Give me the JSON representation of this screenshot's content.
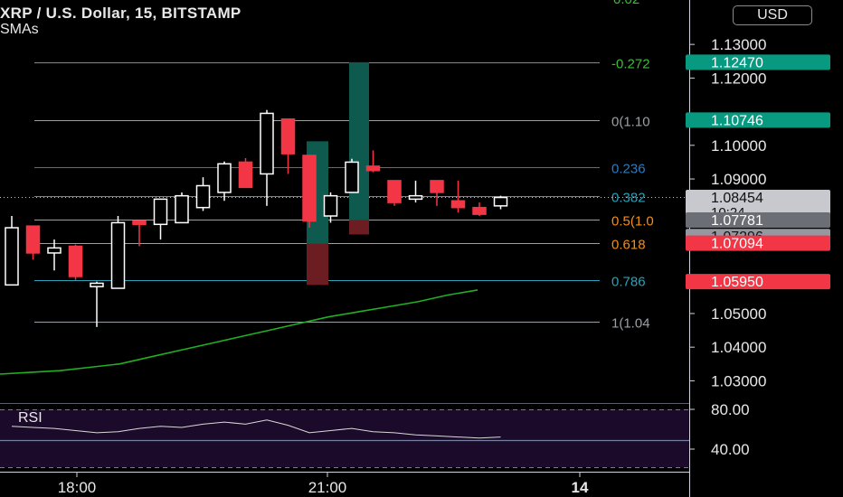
{
  "header": {
    "title": "XRP / U.S. Dollar, 15, BITSTAMP",
    "indicator": "SMAs",
    "currency_button": "USD",
    "top_clipped_label": "0.02"
  },
  "rsi": {
    "label": "RSI",
    "ticks": [
      "80.00",
      "40.00"
    ]
  },
  "colors": {
    "background": "#000000",
    "up_candle": "#ffffff",
    "down_candle": "#f23645",
    "sma_line": "#21b021",
    "rsi_line": "#d8d8d8",
    "rsi_band": "#1c0a2a",
    "price_tag_teal": "#089981",
    "price_tag_red": "#f23645",
    "price_tag_gray": "#9598a1"
  },
  "chart_data": {
    "type": "candlestick",
    "symbol": "XRP / U.S. Dollar",
    "interval": "15",
    "exchange": "BITSTAMP",
    "x_ticks": [
      "18:00",
      "21:00",
      "14"
    ],
    "y_ticks": [
      "1.13000",
      "1.12000",
      "1.10000",
      "1.09000",
      "1.05000",
      "1.04000",
      "1.03000"
    ],
    "y_range": [
      1.0242,
      1.1432
    ],
    "candles": [
      {
        "o": 1.0585,
        "h": 1.079,
        "l": 1.0585,
        "c": 1.0755
      },
      {
        "o": 1.076,
        "h": 1.076,
        "l": 1.066,
        "c": 1.068
      },
      {
        "o": 1.068,
        "h": 1.072,
        "l": 1.0628,
        "c": 1.0695
      },
      {
        "o": 1.07,
        "h": 1.0705,
        "l": 1.06,
        "c": 1.061
      },
      {
        "o": 1.058,
        "h": 1.0595,
        "l": 1.046,
        "c": 1.059
      },
      {
        "o": 1.0575,
        "h": 1.079,
        "l": 1.0575,
        "c": 1.077
      },
      {
        "o": 1.0775,
        "h": 1.0775,
        "l": 1.07,
        "c": 1.0765
      },
      {
        "o": 1.0765,
        "h": 1.0815,
        "l": 1.072,
        "c": 1.084
      },
      {
        "o": 1.077,
        "h": 1.086,
        "l": 1.077,
        "c": 1.085
      },
      {
        "o": 1.0815,
        "h": 1.0905,
        "l": 1.0805,
        "c": 1.088
      },
      {
        "o": 1.086,
        "h": 1.0952,
        "l": 1.0835,
        "c": 1.0945
      },
      {
        "o": 1.095,
        "h": 1.0962,
        "l": 1.0875,
        "c": 1.0875
      },
      {
        "o": 1.0915,
        "h": 1.1105,
        "l": 1.082,
        "c": 1.1095
      },
      {
        "o": 1.1078,
        "h": 1.1078,
        "l": 1.0915,
        "c": 1.0975
      },
      {
        "o": 1.097,
        "h": 1.097,
        "l": 1.0755,
        "c": 1.0775
      },
      {
        "o": 1.079,
        "h": 1.086,
        "l": 1.077,
        "c": 1.085
      },
      {
        "o": 1.086,
        "h": 1.096,
        "l": 1.086,
        "c": 1.095
      },
      {
        "o": 1.0938,
        "h": 1.0985,
        "l": 1.092,
        "c": 1.0925
      },
      {
        "o": 1.0895,
        "h": 1.0895,
        "l": 1.082,
        "c": 1.083
      },
      {
        "o": 1.084,
        "h": 1.0895,
        "l": 1.083,
        "c": 1.085
      },
      {
        "o": 1.0895,
        "h": 1.0895,
        "l": 1.082,
        "c": 1.086
      },
      {
        "o": 1.0835,
        "h": 1.0895,
        "l": 1.08,
        "c": 1.0815
      },
      {
        "o": 1.0815,
        "h": 1.083,
        "l": 1.079,
        "c": 1.0795
      },
      {
        "o": 1.082,
        "h": 1.085,
        "l": 1.081,
        "c": 1.0845
      }
    ],
    "sma": [
      1.032,
      1.0325,
      1.033,
      1.034,
      1.035,
      1.037,
      1.039,
      1.041,
      1.043,
      1.045,
      1.047,
      1.049,
      1.0505,
      1.052,
      1.0535,
      1.0555,
      1.057
    ],
    "fib_levels": [
      {
        "label": "-0.272",
        "price": 1.1247,
        "color": "#3dbb3d"
      },
      {
        "label": "0(1.10",
        "price": 1.1075,
        "color": "#9aa0a6"
      },
      {
        "label": "0.236",
        "price": 1.0935,
        "color": "#2a7bbf"
      },
      {
        "label": "0.382",
        "price": 1.0848,
        "color": "#2aa1b8"
      },
      {
        "label": "0.5(1.0",
        "price": 1.0778,
        "color": "#f28e1c"
      },
      {
        "label": "0.618",
        "price": 1.0709,
        "color": "#f28e1c"
      },
      {
        "label": "0.786",
        "price": 1.06,
        "color": "#2aa1b8"
      },
      {
        "label": "1(1.04",
        "price": 1.0475,
        "color": "#9aa0a6"
      }
    ],
    "price_tags": [
      {
        "text": "1.12470",
        "price": 1.1247,
        "bg": "#089981",
        "fg": "#ffffff"
      },
      {
        "text": "1.10746",
        "price": 1.1075,
        "bg": "#089981",
        "fg": "#ffffff"
      },
      {
        "text": "1.08454",
        "sub": "10:24",
        "price": 1.0845,
        "bg": "#c7c9ce",
        "fg": "#111111"
      },
      {
        "text": "1.07781",
        "price": 1.0778,
        "bg": "#6b6e74",
        "fg": "#ffffff"
      },
      {
        "text": "1.07296",
        "price": 1.0729,
        "bg": "#9598a1",
        "fg": "#111111"
      },
      {
        "text": "1.07094",
        "price": 1.0709,
        "bg": "#f23645",
        "fg": "#ffffff"
      },
      {
        "text": "1.05950",
        "price": 1.0595,
        "bg": "#f23645",
        "fg": "#ffffff"
      }
    ],
    "current_price": 1.08454,
    "rsi_values": [
      64,
      63,
      62,
      60,
      58,
      59,
      62,
      64,
      63,
      66,
      68,
      66,
      70,
      65,
      58,
      60,
      62,
      59,
      58,
      56,
      55,
      54,
      53,
      54
    ]
  }
}
